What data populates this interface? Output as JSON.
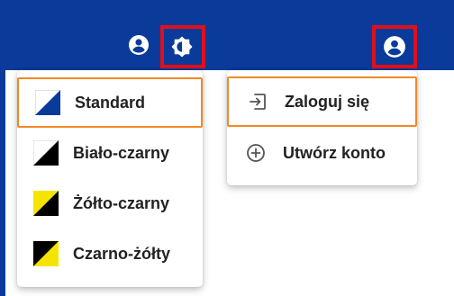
{
  "colors": {
    "header_bg": "#0a3a9a",
    "highlight_border": "#e0101a",
    "selected_item_border": "#f08a24"
  },
  "header": {
    "icons": [
      {
        "name": "user-icon"
      },
      {
        "name": "contrast-icon"
      },
      {
        "name": "user-icon"
      }
    ]
  },
  "contrast_menu": {
    "items": [
      {
        "label": "Standard",
        "icon": "contrast-swatch-standard",
        "selected": true
      },
      {
        "label": "Biało-czarny",
        "icon": "contrast-swatch-white-black",
        "selected": false
      },
      {
        "label": "Żółto-czarny",
        "icon": "contrast-swatch-yellow-black",
        "selected": false
      },
      {
        "label": "Czarno-żółty",
        "icon": "contrast-swatch-black-yellow",
        "selected": false
      }
    ]
  },
  "account_menu": {
    "items": [
      {
        "label": "Zaloguj się",
        "icon": "login-icon",
        "selected": true
      },
      {
        "label": "Utwórz konto",
        "icon": "add-circle-icon",
        "selected": false
      }
    ]
  }
}
